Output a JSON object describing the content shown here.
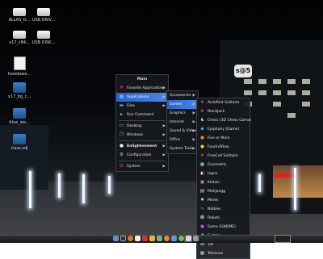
{
  "desktop_icons": [
    {
      "name": "drive",
      "label": "ALLAS_D..."
    },
    {
      "name": "drive",
      "label": "USB DRIV..."
    },
    {
      "name": "drive",
      "label": "x17_c84..."
    },
    {
      "name": "drive",
      "label": "USB DISK..."
    },
    {
      "name": "document",
      "label": "howdowe..."
    },
    {
      "name": "folder",
      "label": "x17_bg_c..."
    },
    {
      "name": "folder",
      "label": "blue_wo..."
    },
    {
      "name": "folder",
      "label": "class.sdj"
    }
  ],
  "main_menu": {
    "title": "Main",
    "items": [
      {
        "label": "Favorite Applications",
        "icon": "heart-icon",
        "has_submenu": true
      },
      {
        "label": "Applications",
        "icon": "apps-icon",
        "has_submenu": true,
        "selected": true
      },
      {
        "label": "Files",
        "icon": "folder-icon",
        "has_submenu": true
      },
      {
        "label": "Run Command",
        "icon": "terminal-icon",
        "has_submenu": false
      },
      {
        "label": "Desktop",
        "icon": "desktop-icon",
        "has_submenu": true
      },
      {
        "label": "Windows",
        "icon": "windows-icon",
        "has_submenu": true
      },
      {
        "label": "Enlightenment",
        "icon": "enlightenment-icon",
        "has_submenu": true
      },
      {
        "label": "Configuration",
        "icon": "gear-icon",
        "has_submenu": true
      },
      {
        "label": "System",
        "icon": "power-icon",
        "has_submenu": true
      }
    ]
  },
  "applications_menu": {
    "items": [
      {
        "label": "Accessories",
        "selected": false
      },
      {
        "label": "Games",
        "selected": true
      },
      {
        "label": "Graphics",
        "selected": false
      },
      {
        "label": "Internet",
        "selected": false
      },
      {
        "label": "Sound & Video",
        "selected": false
      },
      {
        "label": "Office",
        "selected": false
      },
      {
        "label": "System Tools",
        "selected": false
      }
    ]
  },
  "games_menu": {
    "items": [
      {
        "label": "AisleRiot Solitaire"
      },
      {
        "label": "Blackjack"
      },
      {
        "label": "Chess (3D Chess Game)"
      },
      {
        "label": "Epiphany (Game)"
      },
      {
        "label": "Five or More"
      },
      {
        "label": "FourInARow"
      },
      {
        "label": "FreeCell Solitaire"
      },
      {
        "label": "Gnometris"
      },
      {
        "label": "Iagno"
      },
      {
        "label": "Klotski"
      },
      {
        "label": "Mahjongg"
      },
      {
        "label": "Mines"
      },
      {
        "label": "Nibbles"
      },
      {
        "label": "Robots"
      },
      {
        "label": "Same (GNOME)"
      },
      {
        "label": "Sudoku"
      },
      {
        "label": "Tali"
      },
      {
        "label": "Tetravex"
      }
    ]
  },
  "taskbar": {
    "launchers": [
      "file-manager-icon",
      "terminal-icon",
      "browser-icon",
      "text-editor-icon",
      "media-icon",
      "mail-icon",
      "settings-icon",
      "browser-icon",
      "update-icon",
      "chat-icon",
      "calendar-icon",
      "trash-icon"
    ]
  },
  "colors": {
    "accent": "#3a74d8",
    "menu_bg": "#16191d"
  }
}
